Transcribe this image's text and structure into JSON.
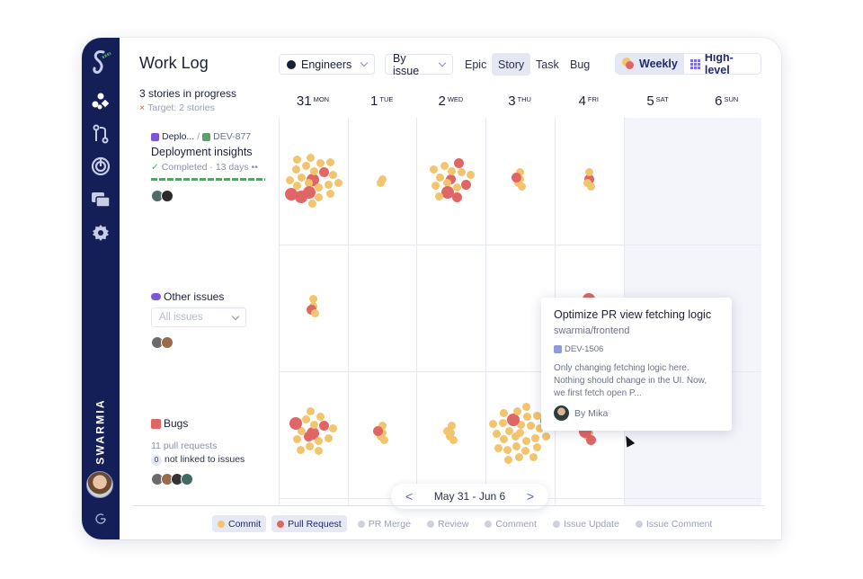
{
  "app": {
    "brand": "SWARMIA",
    "title": "Work Log"
  },
  "sidebar": {
    "items": [
      {
        "icon": "logo-icon"
      },
      {
        "icon": "overview-icon"
      },
      {
        "icon": "pull-requests-icon"
      },
      {
        "icon": "focus-icon"
      },
      {
        "icon": "work-log-icon"
      },
      {
        "icon": "settings-icon"
      }
    ],
    "brand_vertical": "SWARMIA",
    "logout_icon": "logout-icon"
  },
  "toolbar": {
    "team_dropdown": "Engineers",
    "group_dropdown": "By issue",
    "type_tabs": [
      {
        "label": "Epic",
        "active": false
      },
      {
        "label": "Story",
        "active": true
      },
      {
        "label": "Task",
        "active": false
      },
      {
        "label": "Bug",
        "active": false
      }
    ],
    "view_toggle": [
      {
        "label": "Weekly",
        "active": true
      },
      {
        "label": "High-level",
        "active": false
      }
    ]
  },
  "summary": {
    "in_progress": "3 stories in progress",
    "target": "Target: 2 stories"
  },
  "days": [
    {
      "num": "31",
      "dow": "MON",
      "weekend": false
    },
    {
      "num": "1",
      "dow": "TUE",
      "weekend": false
    },
    {
      "num": "2",
      "dow": "WED",
      "weekend": false
    },
    {
      "num": "3",
      "dow": "THU",
      "weekend": false
    },
    {
      "num": "4",
      "dow": "FRI",
      "weekend": false
    },
    {
      "num": "5",
      "dow": "SAT",
      "weekend": true
    },
    {
      "num": "6",
      "dow": "SUN",
      "weekend": true
    }
  ],
  "rows": [
    {
      "epic": "Deplo...",
      "separator": "/",
      "key": "DEV-877",
      "title": "Deployment insights",
      "status": "Completed · 13 days",
      "avatars": 2
    },
    {
      "title": "Other issues",
      "filter": "All issues",
      "avatars": 2
    },
    {
      "title": "Bugs",
      "pull_requests": "11 pull requests",
      "not_linked_count": "0",
      "not_linked": "not linked to issues",
      "avatars": 4
    }
  ],
  "activity": {
    "colors": {
      "commit": "#f2c46d",
      "pull_request": "#e06666"
    },
    "rows": [
      [
        {
          "commits": 18,
          "prs": 5
        },
        {
          "commits": 2,
          "prs": 0
        },
        {
          "commits": 10,
          "prs": 5
        },
        {
          "commits": 4,
          "prs": 1
        },
        {
          "commits": 3,
          "prs": 1
        },
        {
          "commits": 0,
          "prs": 0
        },
        {
          "commits": 0,
          "prs": 0
        }
      ],
      [
        {
          "commits": 3,
          "prs": 1
        },
        {
          "commits": 0,
          "prs": 0
        },
        {
          "commits": 0,
          "prs": 0
        },
        {
          "commits": 0,
          "prs": 0
        },
        {
          "commits": 2,
          "prs": 1
        },
        {
          "commits": 0,
          "prs": 0
        },
        {
          "commits": 0,
          "prs": 0
        }
      ],
      [
        {
          "commits": 12,
          "prs": 4
        },
        {
          "commits": 4,
          "prs": 1
        },
        {
          "commits": 5,
          "prs": 0
        },
        {
          "commits": 26,
          "prs": 2
        },
        {
          "commits": 3,
          "prs": 2
        },
        {
          "commits": 0,
          "prs": 0
        },
        {
          "commits": 0,
          "prs": 0
        }
      ]
    ]
  },
  "tooltip": {
    "title": "Optimize PR view fetching logic",
    "repo": "swarmia/frontend",
    "key": "DEV-1506",
    "description": "Only changing fetching logic here. Nothing should change in the UI. Now, we first fetch open P...",
    "author": "By Mika"
  },
  "pager": {
    "prev": "<",
    "range": "May 31 - Jun 6",
    "next": ">"
  },
  "legend": [
    {
      "label": "Commit",
      "color": "#f2c46d",
      "active": true
    },
    {
      "label": "Pull Request",
      "color": "#e06666",
      "active": true
    },
    {
      "label": "PR Merge",
      "color": "#cfd2db",
      "active": false
    },
    {
      "label": "Review",
      "color": "#cfd2db",
      "active": false
    },
    {
      "label": "Comment",
      "color": "#cfd2db",
      "active": false
    },
    {
      "label": "Issue Update",
      "color": "#cfd2db",
      "active": false
    },
    {
      "label": "Issue Comment",
      "color": "#cfd2db",
      "active": false
    }
  ]
}
